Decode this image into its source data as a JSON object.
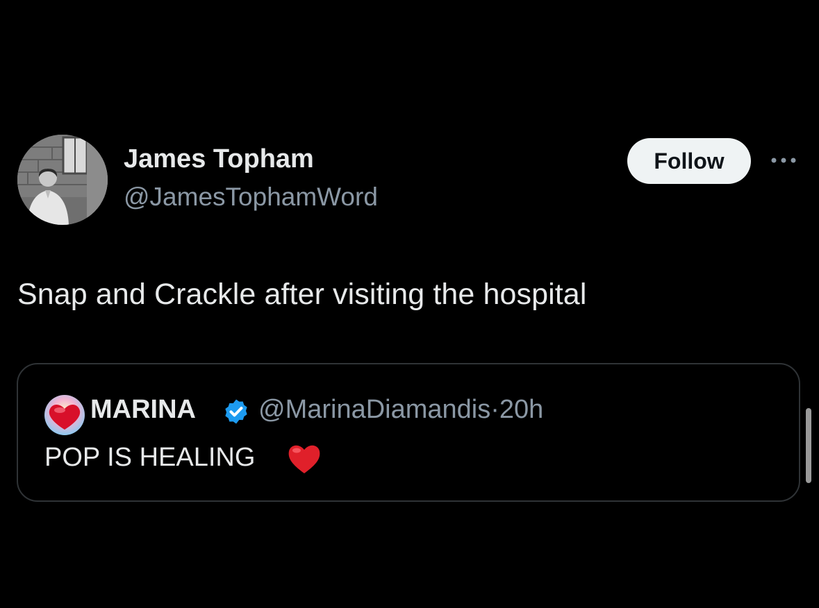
{
  "tweet": {
    "author": {
      "name": "James Topham",
      "handle": "@JamesTophamWord",
      "avatar_icon": "profile-photo"
    },
    "follow_label": "Follow",
    "more_icon": "more-horizontal-icon",
    "text": "Snap and Crackle after visiting the hospital",
    "quote": {
      "author_name": "MARINA",
      "verified_icon": "verified-badge-icon",
      "handle": "@MarinaDiamandis",
      "separator": "·",
      "time": "20h",
      "text": "POP IS HEALING",
      "emoji_icon": "red-heart-emoji"
    }
  },
  "colors": {
    "background": "#000000",
    "primary_text": "#e7e9ea",
    "secondary_text": "#8b98a5",
    "follow_bg": "#eff3f4",
    "border": "#2f3336",
    "verified_blue": "#1d9bf0",
    "heart_red": "#e0202a"
  }
}
